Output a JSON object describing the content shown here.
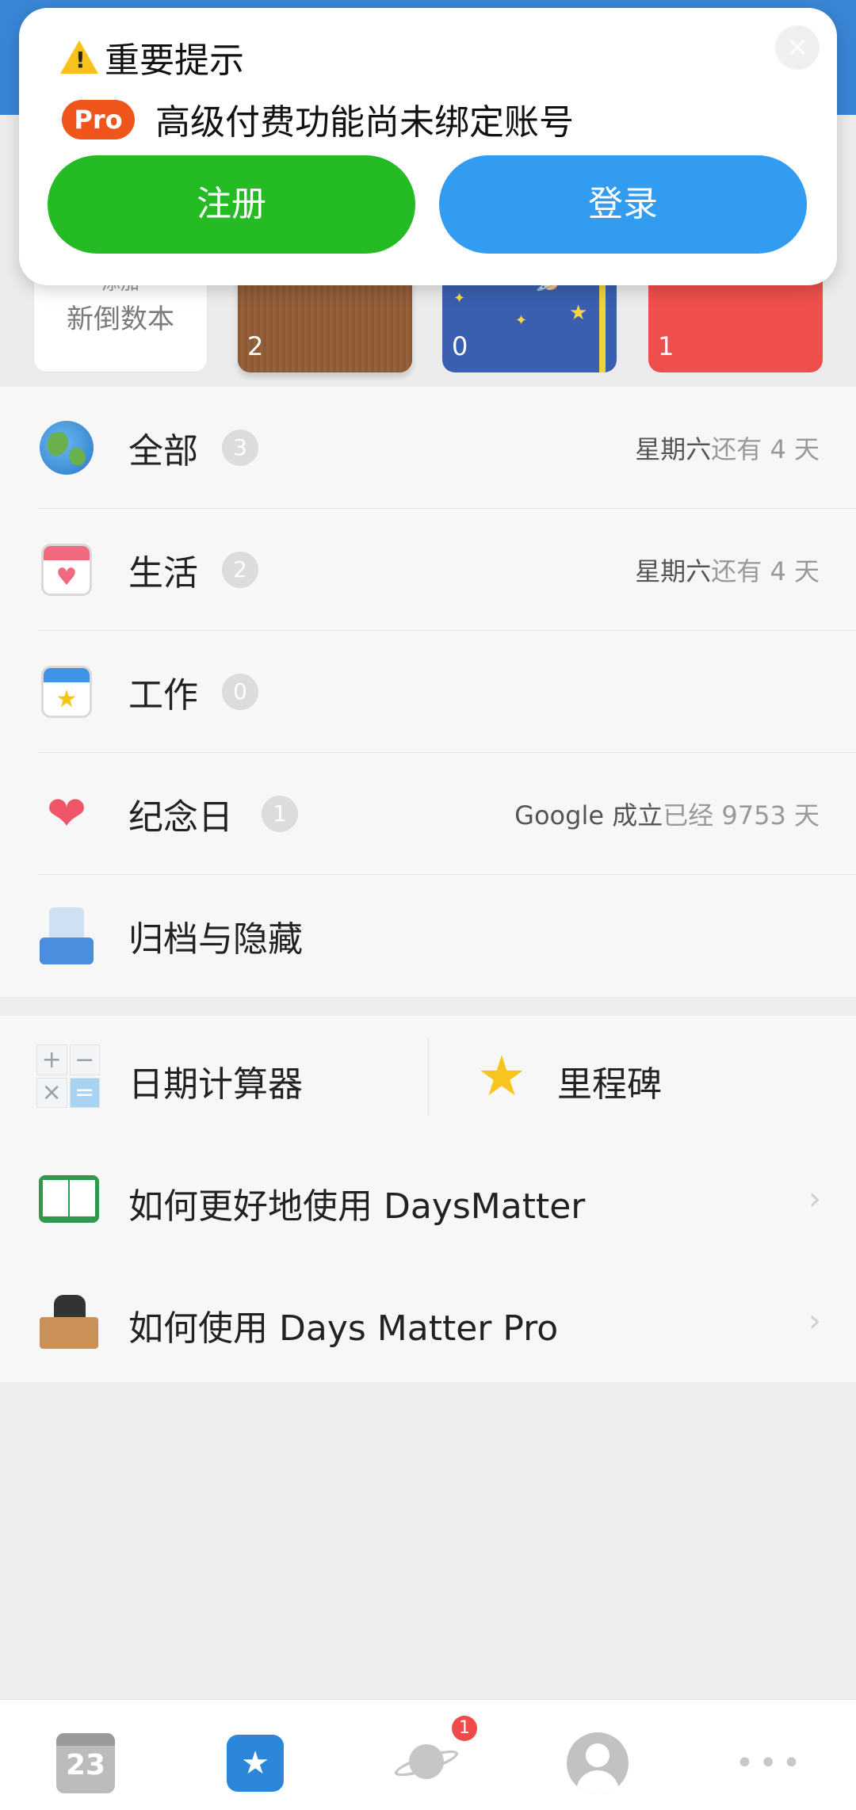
{
  "dialog": {
    "title": "重要提示",
    "pro_badge": "Pro",
    "message": "高级付费功能尚未绑定账号",
    "close_label": "×",
    "register_label": "注册",
    "login_label": "登录"
  },
  "books": {
    "new_book_top": "添加",
    "new_book_label": "新倒数本",
    "items": [
      {
        "count": "2",
        "color": "#8b5a35"
      },
      {
        "count": "0",
        "color": "#3a5fb0"
      },
      {
        "count": "1",
        "color": "#ef4f4c"
      }
    ]
  },
  "categories": [
    {
      "icon": "globe-icon",
      "label": "全部",
      "count": "3",
      "detail_main": "星期六",
      "detail_muted": "还有 4 天"
    },
    {
      "icon": "heart-calendar-icon",
      "label": "生活",
      "count": "2",
      "detail_main": "星期六",
      "detail_muted": "还有 4 天"
    },
    {
      "icon": "star-calendar-icon",
      "label": "工作",
      "count": "0",
      "detail_main": "",
      "detail_muted": ""
    },
    {
      "icon": "hearts-icon",
      "label": "纪念日",
      "count": "1",
      "detail_main": "Google 成立",
      "detail_muted": "已经 9753 天"
    },
    {
      "icon": "archive-icon",
      "label": "归档与隐藏",
      "count": "",
      "detail_main": "",
      "detail_muted": ""
    }
  ],
  "tools": {
    "date_calculator": "日期计算器",
    "milestones": "里程碑",
    "help_link": "如何更好地使用 DaysMatter",
    "pro_help_link": "如何使用 Days Matter Pro",
    "chevron": "›"
  },
  "bottom_nav": {
    "calendar_day": "23",
    "notification_count": "1",
    "more": "•••"
  },
  "colors": {
    "top_bar": "#3a86d6",
    "register": "#25bb24",
    "login": "#329cf0",
    "pro": "#f0561c"
  }
}
